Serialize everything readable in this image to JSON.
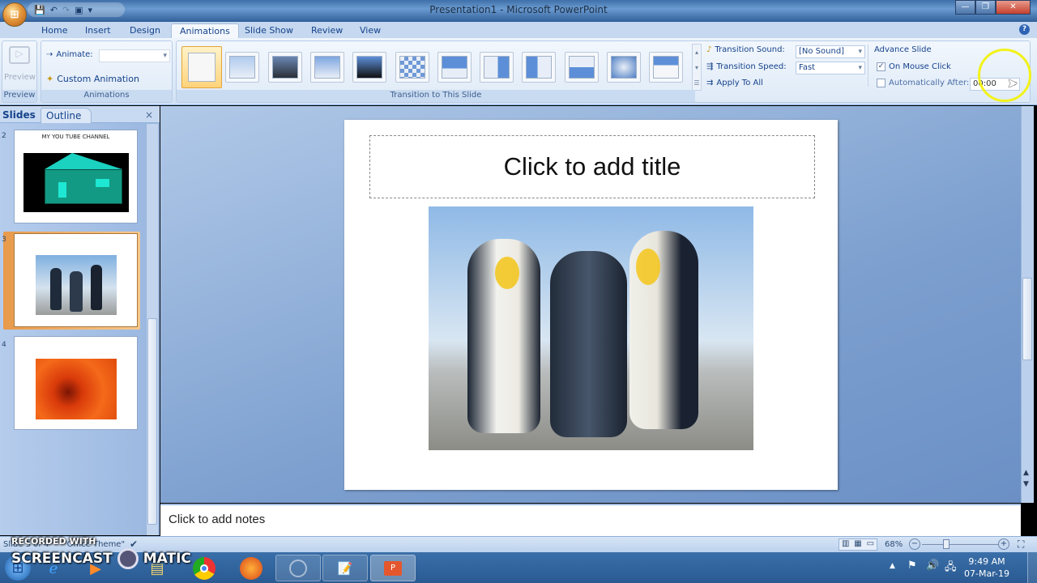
{
  "window": {
    "title": "Presentation1 - Microsoft PowerPoint",
    "controls": {
      "minimize": "—",
      "restore": "❐",
      "close": "✕"
    }
  },
  "quick_access": {
    "icons": [
      "save-icon",
      "undo-icon",
      "redo-icon",
      "layout-icon",
      "customize-icon"
    ]
  },
  "tabs": [
    {
      "label": "Home",
      "active": false
    },
    {
      "label": "Insert",
      "active": false
    },
    {
      "label": "Design",
      "active": false
    },
    {
      "label": "Animations",
      "active": true
    },
    {
      "label": "Slide Show",
      "active": false
    },
    {
      "label": "Review",
      "active": false
    },
    {
      "label": "View",
      "active": false
    }
  ],
  "ribbon": {
    "preview_group": {
      "button_label": "Preview",
      "group_label": "Preview"
    },
    "animations_group": {
      "animate_label": "Animate:",
      "animate_value": "",
      "custom_animation_label": "Custom Animation",
      "group_label": "Animations"
    },
    "transition_group": {
      "group_label": "Transition to This Slide",
      "thumbnails": [
        "No Transition",
        "Fade Smoothly",
        "Fade Through Black",
        "Cut",
        "Cut Through Black",
        "Dissolve",
        "Wipe Down",
        "Wipe Left",
        "Wipe Right",
        "Wipe Up",
        "Wheel Clockwise",
        "Uncover Down"
      ],
      "selected_index": 0,
      "sound_label": "Transition Sound:",
      "sound_value": "[No Sound]",
      "speed_label": "Transition Speed:",
      "speed_value": "Fast",
      "apply_all_label": "Apply To All"
    },
    "advance_group": {
      "title": "Advance Slide",
      "on_mouse_click_label": "On Mouse Click",
      "on_mouse_click_checked": true,
      "auto_after_label": "Automatically After:",
      "auto_after_checked": false,
      "auto_after_value": "00:00"
    }
  },
  "left_pane": {
    "tabs": [
      {
        "label": "Slides",
        "active": true
      },
      {
        "label": "Outline",
        "active": false
      }
    ],
    "close": "×",
    "slides": [
      {
        "number": "2",
        "title": "MY YOU TUBE CHANNEL",
        "content": "house drawing",
        "selected": false
      },
      {
        "number": "3",
        "title": "",
        "content": "penguins picture",
        "selected": true
      },
      {
        "number": "4",
        "title": "",
        "content": "orange flower picture",
        "selected": false
      }
    ]
  },
  "slide": {
    "title_placeholder": "Click to add title",
    "picture": "penguins"
  },
  "notes": {
    "placeholder": "Click to add notes"
  },
  "statusbar": {
    "slide_info": "Slide 3 of 4",
    "theme": "\"Office Theme\"",
    "zoom": "68%",
    "zoom_out": "−",
    "zoom_in": "+"
  },
  "watermark": {
    "line1": "RECORDED WITH",
    "line2": "SCREENCAST",
    "line3": "MATIC"
  },
  "taskbar": {
    "time": "9:49 AM",
    "date": "07-Mar-19"
  }
}
